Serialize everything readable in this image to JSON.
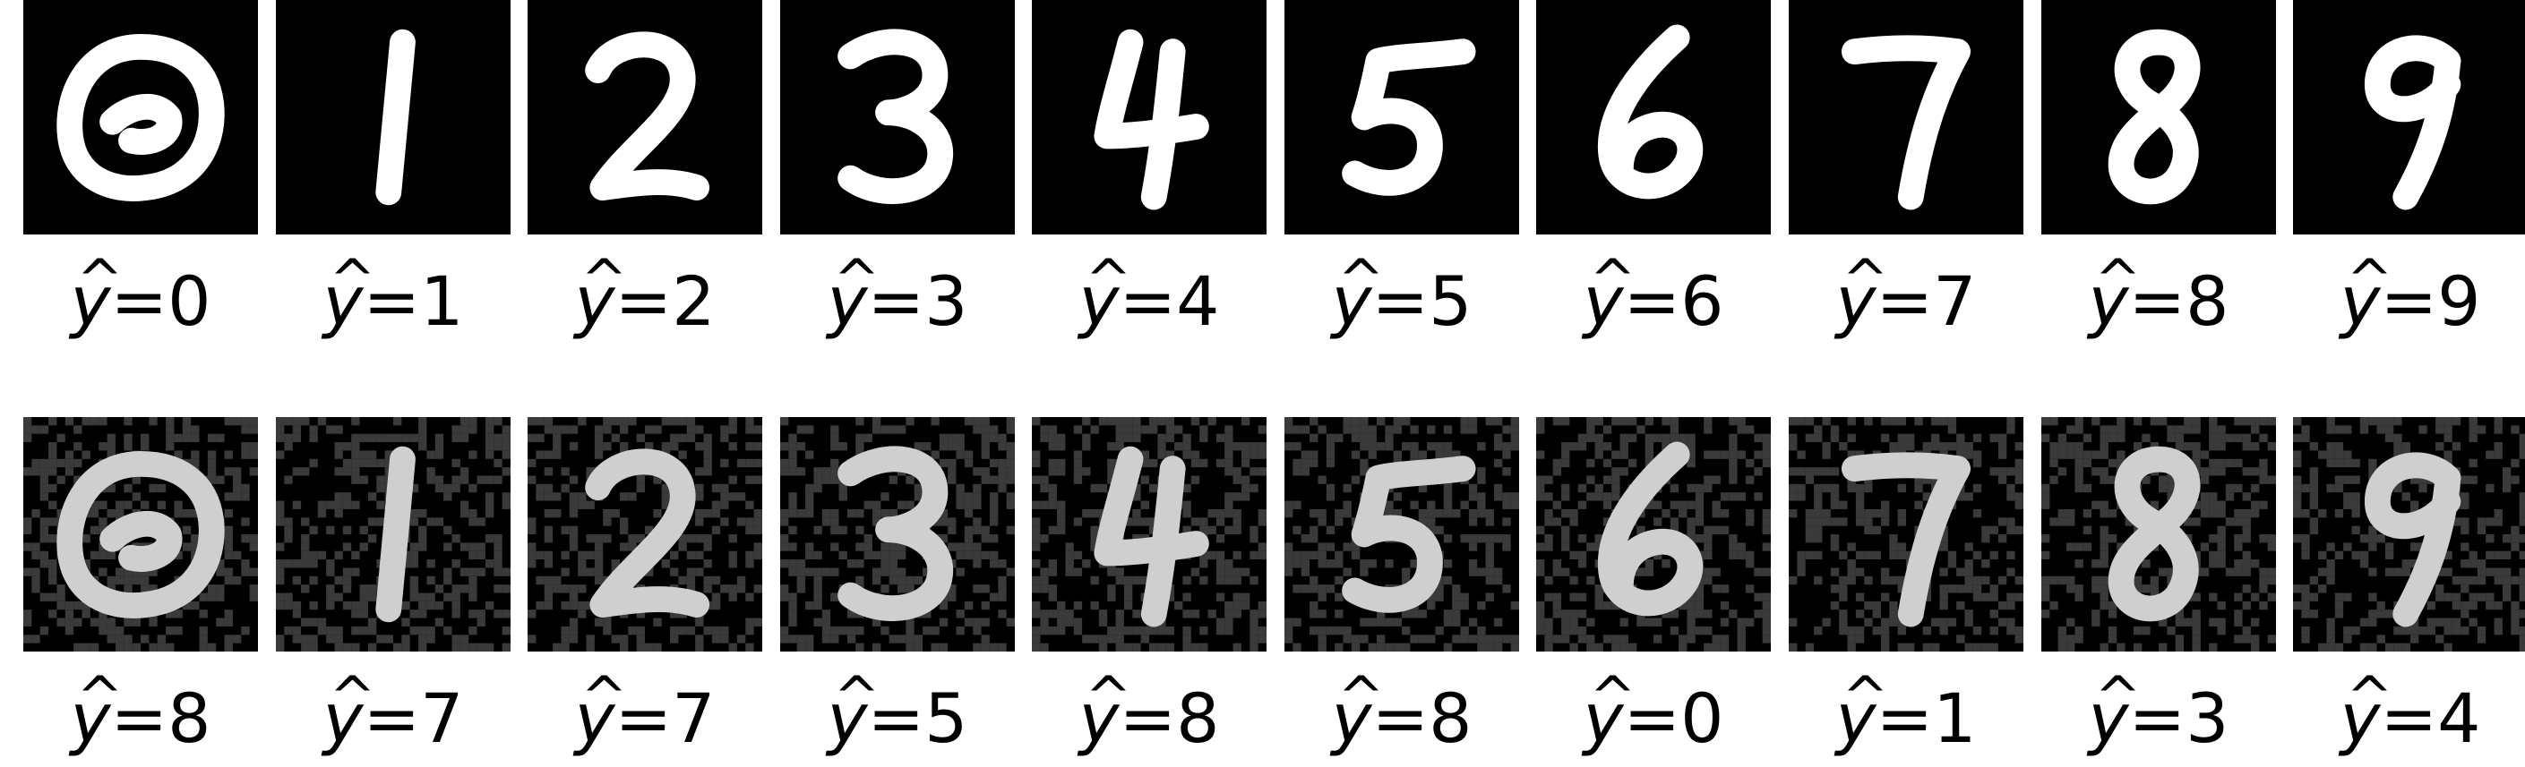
{
  "figure": {
    "rows": [
      {
        "id": "clean",
        "cells": [
          {
            "digit": "0",
            "pred_symbol": "y",
            "equals": "=",
            "pred_value": "0"
          },
          {
            "digit": "1",
            "pred_symbol": "y",
            "equals": "=",
            "pred_value": "1"
          },
          {
            "digit": "2",
            "pred_symbol": "y",
            "equals": "=",
            "pred_value": "2"
          },
          {
            "digit": "3",
            "pred_symbol": "y",
            "equals": "=",
            "pred_value": "3"
          },
          {
            "digit": "4",
            "pred_symbol": "y",
            "equals": "=",
            "pred_value": "4"
          },
          {
            "digit": "5",
            "pred_symbol": "y",
            "equals": "=",
            "pred_value": "5"
          },
          {
            "digit": "6",
            "pred_symbol": "y",
            "equals": "=",
            "pred_value": "6"
          },
          {
            "digit": "7",
            "pred_symbol": "y",
            "equals": "=",
            "pred_value": "7"
          },
          {
            "digit": "8",
            "pred_symbol": "y",
            "equals": "=",
            "pred_value": "8"
          },
          {
            "digit": "9",
            "pred_symbol": "y",
            "equals": "=",
            "pred_value": "9"
          }
        ]
      },
      {
        "id": "adversarial",
        "cells": [
          {
            "digit": "0",
            "pred_symbol": "y",
            "equals": "=",
            "pred_value": "8"
          },
          {
            "digit": "1",
            "pred_symbol": "y",
            "equals": "=",
            "pred_value": "7"
          },
          {
            "digit": "2",
            "pred_symbol": "y",
            "equals": "=",
            "pred_value": "7"
          },
          {
            "digit": "3",
            "pred_symbol": "y",
            "equals": "=",
            "pred_value": "5"
          },
          {
            "digit": "4",
            "pred_symbol": "y",
            "equals": "=",
            "pred_value": "8"
          },
          {
            "digit": "5",
            "pred_symbol": "y",
            "equals": "=",
            "pred_value": "8"
          },
          {
            "digit": "6",
            "pred_symbol": "y",
            "equals": "=",
            "pred_value": "0"
          },
          {
            "digit": "7",
            "pred_symbol": "y",
            "equals": "=",
            "pred_value": "1"
          },
          {
            "digit": "8",
            "pred_symbol": "y",
            "equals": "=",
            "pred_value": "3"
          },
          {
            "digit": "9",
            "pred_symbol": "y",
            "equals": "=",
            "pred_value": "4"
          }
        ]
      }
    ],
    "colors": {
      "image_background": "#000000",
      "stroke_clean": "#ffffff",
      "stroke_adversarial": "#cfcfcf",
      "noise": "#3a3a3a",
      "caption_text": "#000000"
    }
  }
}
